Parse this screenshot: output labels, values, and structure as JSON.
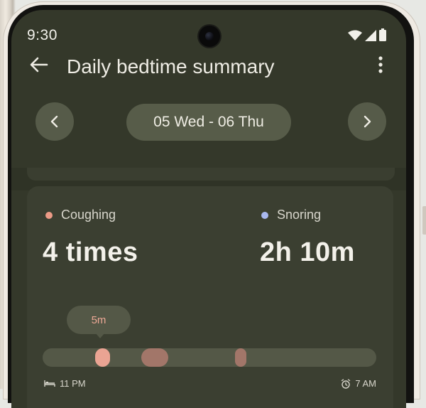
{
  "status_bar": {
    "time": "9:30",
    "icons": [
      "wifi-icon",
      "cell-signal-icon",
      "battery-icon"
    ]
  },
  "app_bar": {
    "title": "Daily bedtime summary",
    "back_icon": "arrow-back-icon",
    "menu_icon": "more-vert-icon"
  },
  "date_nav": {
    "range": "05 Wed - 06 Thu",
    "prev_icon": "chevron-left-icon",
    "next_icon": "chevron-right-icon"
  },
  "metrics": {
    "coughing": {
      "label": "Coughing",
      "value": "4 times",
      "color": "#eb9a86"
    },
    "snoring": {
      "label": "Snoring",
      "value": "2h 10m",
      "color": "#a9b8ef"
    }
  },
  "timeline": {
    "tooltip": "5m",
    "start": "11 PM",
    "end": "7 AM",
    "start_icon": "bed-icon",
    "end_icon": "alarm-icon",
    "events": [
      {
        "start_fraction": 0.157,
        "end_fraction": 0.202,
        "color": "#eaa493"
      },
      {
        "start_fraction": 0.296,
        "end_fraction": 0.376,
        "color": "#a27669"
      },
      {
        "start_fraction": 0.577,
        "end_fraction": 0.611,
        "color": "#a27669"
      }
    ]
  },
  "colors": {
    "screen_background": "#34382a",
    "card_background": "#3b3f31",
    "control_background": "#575c49",
    "text_primary": "#eeece4"
  }
}
